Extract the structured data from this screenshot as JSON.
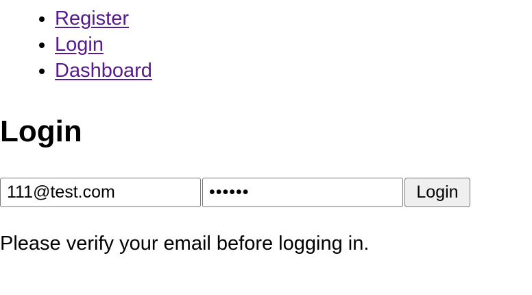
{
  "nav": {
    "items": [
      {
        "label": "Register"
      },
      {
        "label": "Login"
      },
      {
        "label": "Dashboard"
      }
    ]
  },
  "page": {
    "title": "Login"
  },
  "form": {
    "email_value": "111@test.com",
    "password_value": "••••••",
    "submit_label": "Login"
  },
  "status": {
    "message": "Please verify your email before logging in."
  },
  "colors": {
    "link": "#551a8b",
    "button_bg": "#efefef",
    "input_border": "#767676"
  }
}
